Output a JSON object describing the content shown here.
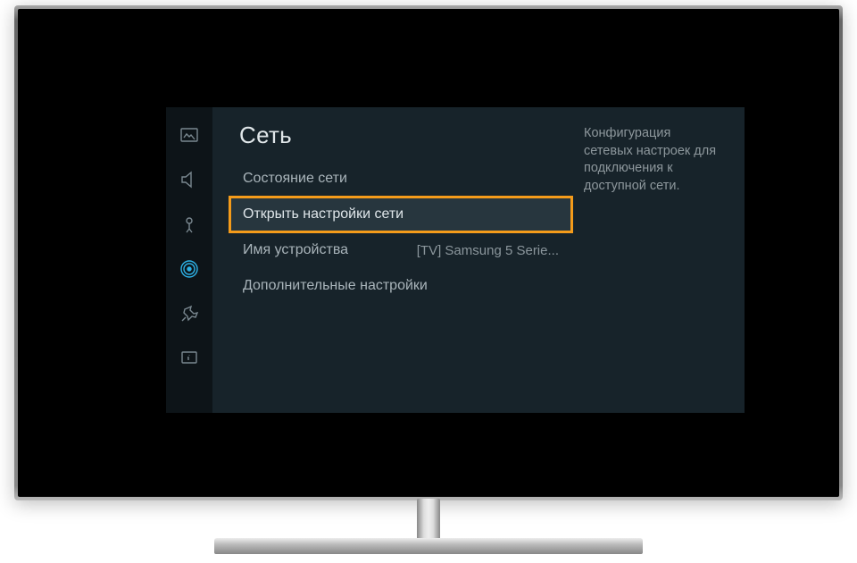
{
  "section_title": "Сеть",
  "menu": {
    "network_status": "Состояние сети",
    "open_network_settings": "Открыть настройки сети",
    "device_name_label": "Имя устройства",
    "device_name_value": "[TV] Samsung 5 Serie...",
    "advanced_settings": "Дополнительные настройки"
  },
  "description": "Конфигурация сетевых настроек для подключения к доступной сети.",
  "sidebar_icons": {
    "picture": "picture-icon",
    "sound": "sound-icon",
    "broadcast": "broadcast-icon",
    "network": "network-icon",
    "system": "system-icon",
    "support": "support-icon"
  }
}
